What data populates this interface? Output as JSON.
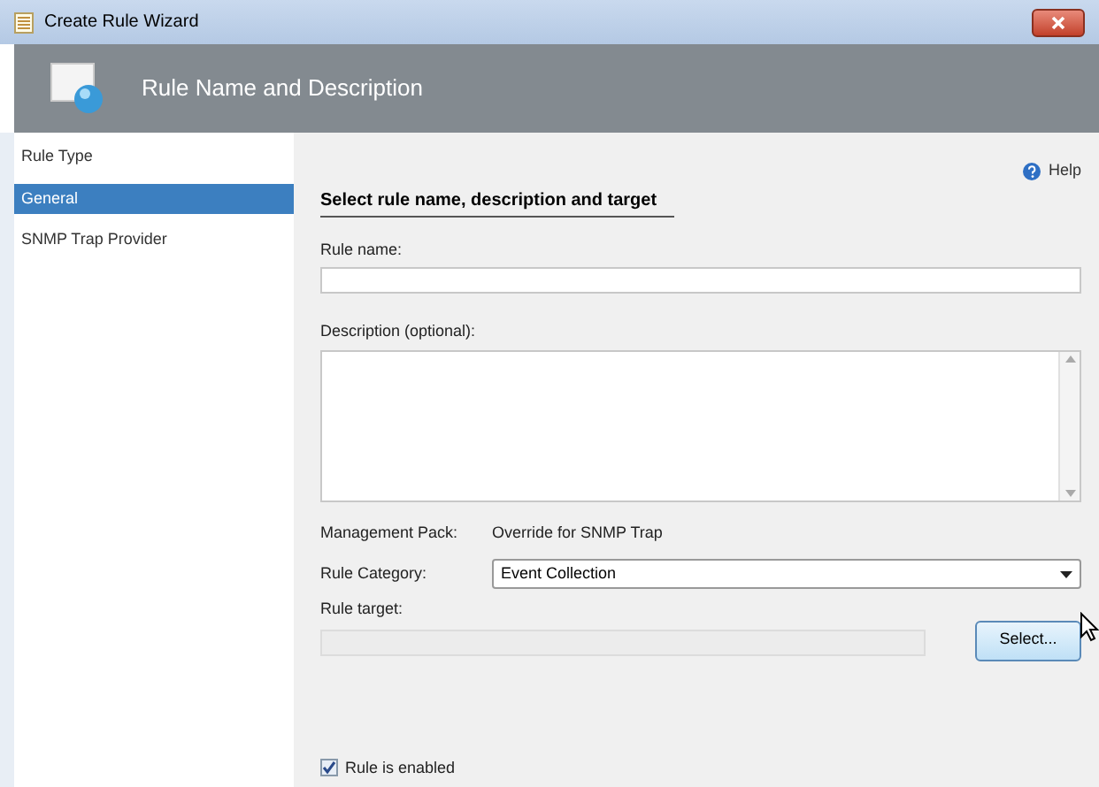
{
  "window": {
    "title": "Create Rule Wizard"
  },
  "header": {
    "title": "Rule Name and Description"
  },
  "sidebar": {
    "items": [
      {
        "label": "Rule Type",
        "selected": false
      },
      {
        "label": "General",
        "selected": true
      },
      {
        "label": "SNMP Trap Provider",
        "selected": false
      }
    ]
  },
  "help": "Help",
  "section_title": "Select rule name, description and target",
  "rule_name": {
    "label": "Rule name:"
  },
  "description": {
    "label": "Description (optional):"
  },
  "management_pack": {
    "label": "Management Pack:",
    "value": "Override for SNMP Trap"
  },
  "rule_category": {
    "label": "Rule Category:",
    "value": "Event Collection"
  },
  "rule_target": {
    "label": "Rule target:",
    "disabled": true,
    "button": "Select..."
  },
  "enabled": {
    "label": "Rule is enabled",
    "checked": true
  }
}
